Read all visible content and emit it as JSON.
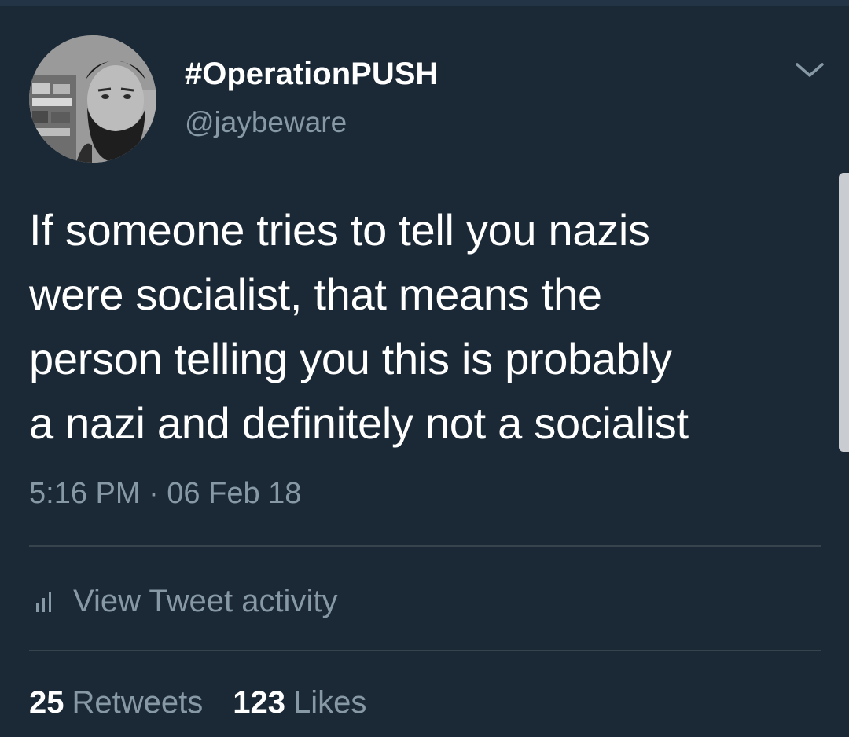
{
  "tweet": {
    "author": {
      "display_name": "#OperationPUSH",
      "handle": "@jaybeware",
      "avatar_icon": "user-avatar-photo"
    },
    "text_lines": [
      "If someone tries to tell you nazis",
      "were socialist, that means the",
      "person telling you this is probably",
      "a nazi and definitely not a socialist"
    ],
    "timestamp": "5:16 PM · 06 Feb 18",
    "activity_label": "View Tweet activity",
    "stats": {
      "retweets_count": "25",
      "retweets_label": "Retweets",
      "likes_count": "123",
      "likes_label": "Likes"
    }
  },
  "colors": {
    "background": "#1b2836",
    "primary_text": "#ffffff",
    "secondary_text": "#8899a6",
    "divider": "#38444d"
  },
  "icons": {
    "menu": "chevron-down-icon",
    "activity": "bar-chart-icon"
  }
}
